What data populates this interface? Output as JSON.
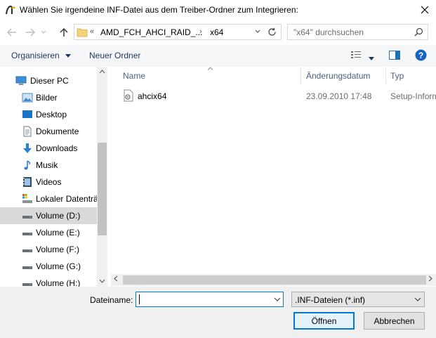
{
  "window": {
    "title": "Wählen Sie irgendeine INF-Datei aus dem Treiber-Ordner zum Integrieren:"
  },
  "navigation": {
    "breadcrumb_overflow": "«",
    "breadcrumbs": [
      "AMD_FCH_AHCI_RAID_...",
      "x64"
    ],
    "search_placeholder": "\"x64\" durchsuchen"
  },
  "toolbar": {
    "organize_label": "Organisieren",
    "new_folder_label": "Neuer Ordner"
  },
  "sidebar": {
    "items": [
      {
        "label": "Dieser PC",
        "icon": "pc-icon"
      },
      {
        "label": "Bilder",
        "icon": "pictures-icon"
      },
      {
        "label": "Desktop",
        "icon": "desktop-icon"
      },
      {
        "label": "Dokumente",
        "icon": "documents-icon"
      },
      {
        "label": "Downloads",
        "icon": "downloads-icon"
      },
      {
        "label": "Musik",
        "icon": "music-icon"
      },
      {
        "label": "Videos",
        "icon": "videos-icon"
      },
      {
        "label": "Lokaler Datenträ",
        "icon": "local-disk-icon"
      },
      {
        "label": "Volume (D:)",
        "icon": "drive-icon",
        "selected": true
      },
      {
        "label": "Volume (E:)",
        "icon": "drive-icon"
      },
      {
        "label": "Volume (F:)",
        "icon": "drive-icon"
      },
      {
        "label": "Volume (G:)",
        "icon": "drive-icon"
      },
      {
        "label": "Volume (H:)",
        "icon": "drive-icon"
      }
    ]
  },
  "file_list": {
    "columns": [
      "Name",
      "Änderungsdatum",
      "Typ"
    ],
    "rows": [
      {
        "name": "ahcix64",
        "date": "23.09.2010 17:48",
        "type": "Setup-Inform",
        "icon": "inf-file-icon"
      }
    ]
  },
  "footer": {
    "filename_label": "Dateiname:",
    "filename_value": "",
    "filetype_value": ".INF-Dateien (*.inf)",
    "open_label": "Öffnen",
    "cancel_label": "Abbrechen"
  },
  "colors": {
    "accent": "#0078d7",
    "selection": "#d9d9d9",
    "folder": "#e8c766"
  }
}
